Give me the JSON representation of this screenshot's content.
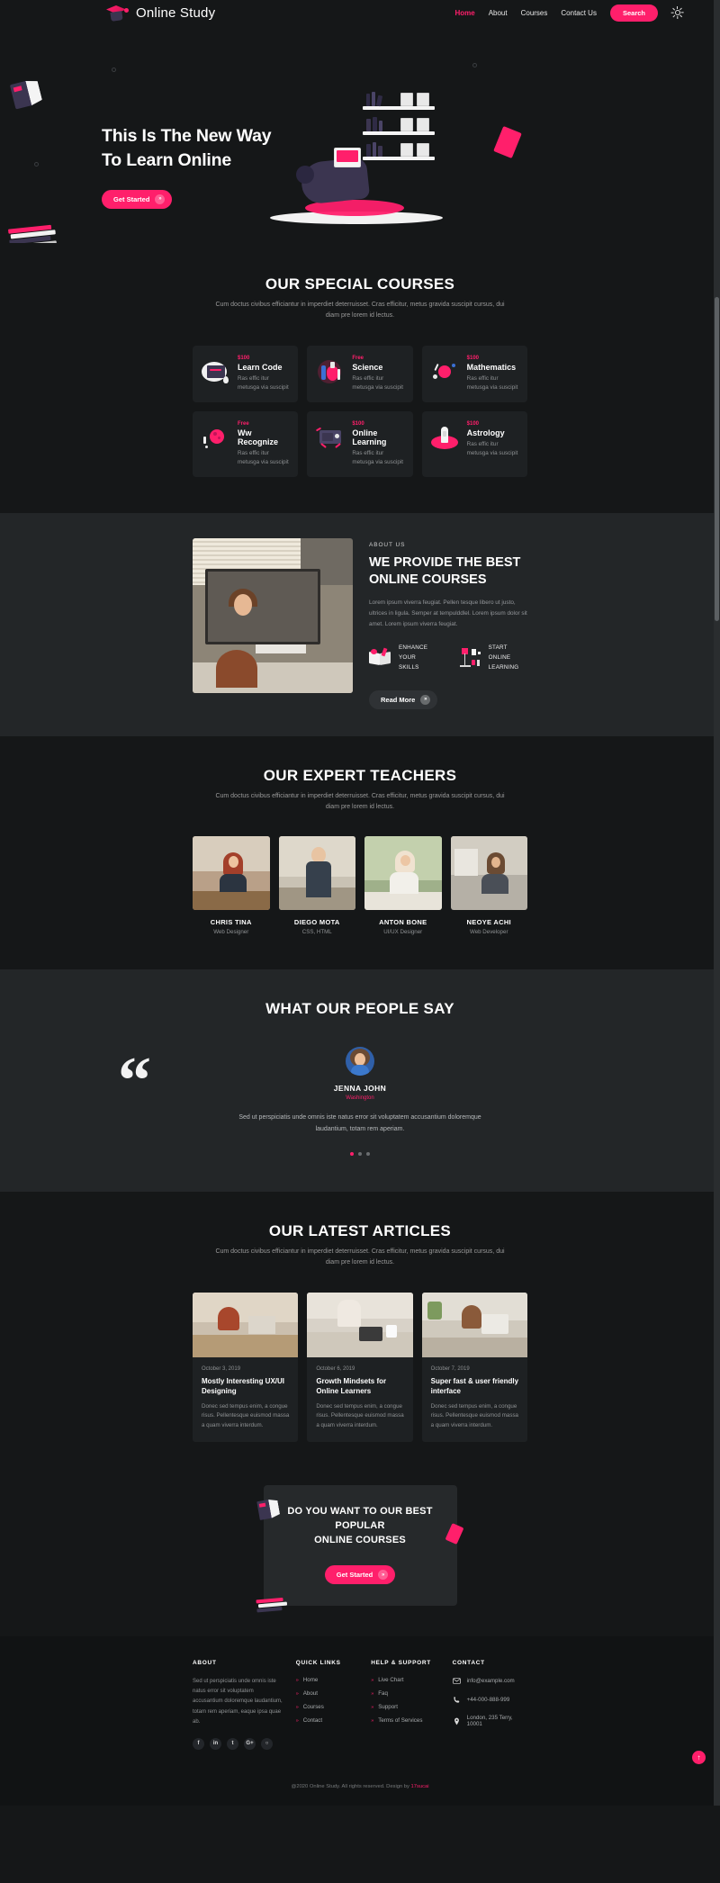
{
  "header": {
    "brand": "Online Study",
    "logo_icon": "graduation-cap-icon",
    "nav": [
      {
        "label": "Home",
        "active": true
      },
      {
        "label": "About",
        "active": false
      },
      {
        "label": "Courses",
        "active": false
      },
      {
        "label": "Contact Us",
        "active": false
      }
    ],
    "search_label": "Search",
    "theme_toggle_icon": "sun-icon",
    "accent_color": "#ff1f6b"
  },
  "hero": {
    "title_line1": "This Is The New Way",
    "title_line2": "To Learn Online",
    "cta_label": "Get Started",
    "cta_icon": "chevron-right-icon"
  },
  "courses": {
    "title": "OUR SPECIAL COURSES",
    "subtitle": "Cum doctus civibus efficiantur in imperdiet deterruisset. Cras efficitur, metus gravida suscipit cursus, dui diam pre lorem id lectus.",
    "items": [
      {
        "price": "$100",
        "name": "Learn Code",
        "desc": "Ras effic itur metusga via suscipit",
        "icon": "laptop-code-icon"
      },
      {
        "price": "Free",
        "name": "Science",
        "desc": "Ras effic itur metusga via suscipit",
        "icon": "flask-icon"
      },
      {
        "price": "$100",
        "name": "Mathematics",
        "desc": "Ras effic itur metusga via suscipit",
        "icon": "atom-icon"
      },
      {
        "price": "Free",
        "name": "Ww Recognize",
        "desc": "Ras effic itur metusga via suscipit",
        "icon": "globe-icon"
      },
      {
        "price": "$100",
        "name": "Online Learning",
        "desc": "Ras effic itur metusga via suscipit",
        "icon": "presentation-icon"
      },
      {
        "price": "$100",
        "name": "Astrology",
        "desc": "Ras effic itur metusga via suscipit",
        "icon": "rocket-icon"
      }
    ]
  },
  "about": {
    "eyebrow": "ABOUT US",
    "title_line1": "WE PROVIDE THE BEST",
    "title_line2": "ONLINE COURSES",
    "paragraph": "Lorem ipsum viverra feugiat. Pellen tesque libero ut justo, ultrices in ligula. Semper at tempulddlel. Lorem ipsum dolor sit amet. Lorem ipsum viverra feugiat.",
    "features": [
      {
        "icon": "open-book-icon",
        "line1": "ENHANCE YOUR",
        "line2": "SKILLS"
      },
      {
        "icon": "teacher-board-icon",
        "line1": "START ONLINE",
        "line2": "LEARNING"
      }
    ],
    "cta_label": "Read More",
    "cta_icon": "chevron-right-icon"
  },
  "teachers": {
    "title": "OUR EXPERT TEACHERS",
    "subtitle": "Cum doctus civibus efficiantur in imperdiet deterruisset. Cras efficitur, metus gravida suscipit cursus, dui diam pre lorem id lectus.",
    "items": [
      {
        "name": "CHRIS TINA",
        "role": "Web Designer"
      },
      {
        "name": "DIEGO MOTA",
        "role": "CSS, HTML"
      },
      {
        "name": "ANTON BONE",
        "role": "UI/UX Designer"
      },
      {
        "name": "NEOYE ACHI",
        "role": "Web Developer"
      }
    ]
  },
  "testimonial": {
    "title": "WHAT OUR PEOPLE SAY",
    "quote_icon": "quotation-mark-icon",
    "avatar_icon": "avatar",
    "name": "JENNA JOHN",
    "location": "Washington",
    "text": "Sed ut perspiciatis unde omnis iste natus error sit voluptatem accusantium doloremque laudantium, totam rem aperiam.",
    "dots": [
      true,
      false,
      false
    ]
  },
  "articles": {
    "title": "OUR LATEST ARTICLES",
    "subtitle": "Cum doctus civibus efficiantur in imperdiet deterruisset. Cras efficitur, metus gravida suscipit cursus, dui diam pre lorem id lectus.",
    "items": [
      {
        "date": "October 3, 2019",
        "title": "Mostly Interesting UX/UI Designing",
        "text": "Donec sed tempus enim, a congue risus. Pellentesque euismod massa a quam viverra interdum."
      },
      {
        "date": "October 6, 2019",
        "title": "Growth Mindsets for Online Learners",
        "text": "Donec sed tempus enim, a congue risus. Pellentesque euismod massa a quam viverra interdum."
      },
      {
        "date": "October 7, 2019",
        "title": "Super fast & user friendly interface",
        "text": "Donec sed tempus enim, a congue risus. Pellentesque euismod massa a quam viverra interdum."
      }
    ]
  },
  "cta": {
    "title_line1": "DO YOU WANT TO OUR BEST POPULAR",
    "title_line2": "ONLINE COURSES",
    "button_label": "Get Started",
    "button_icon": "chevron-right-icon"
  },
  "footer": {
    "about": {
      "heading": "ABOUT",
      "text": "Sed ut perspiciatis unde omnis iste natus error sit voluptatem accusantium doloremque laudantium, totam rem aperiam, eaque ipsa quae ab.",
      "socials": [
        {
          "icon": "facebook-icon",
          "glyph": "f"
        },
        {
          "icon": "linkedin-icon",
          "glyph": "in"
        },
        {
          "icon": "twitter-icon",
          "glyph": "t"
        },
        {
          "icon": "google-plus-icon",
          "glyph": "G+"
        },
        {
          "icon": "github-icon",
          "glyph": "○"
        }
      ]
    },
    "quick_links": {
      "heading": "QUICK LINKS",
      "items": [
        "Home",
        "About",
        "Courses",
        "Contact"
      ]
    },
    "help": {
      "heading": "HELP & SUPPORT",
      "items": [
        "Live Chart",
        "Faq",
        "Support",
        "Terms of Services"
      ]
    },
    "contact": {
      "heading": "CONTACT",
      "items": [
        {
          "icon": "mail-icon",
          "text": "info@example.com"
        },
        {
          "icon": "phone-icon",
          "text": "+44-000-888-999"
        },
        {
          "icon": "location-pin-icon",
          "text": "London, 235 Terry, 10001"
        }
      ]
    },
    "copyright": "@2020 Online Study. All rights reserved. Design by ",
    "copyright_link": "17sucai",
    "back_to_top_icon": "arrow-up-icon"
  }
}
